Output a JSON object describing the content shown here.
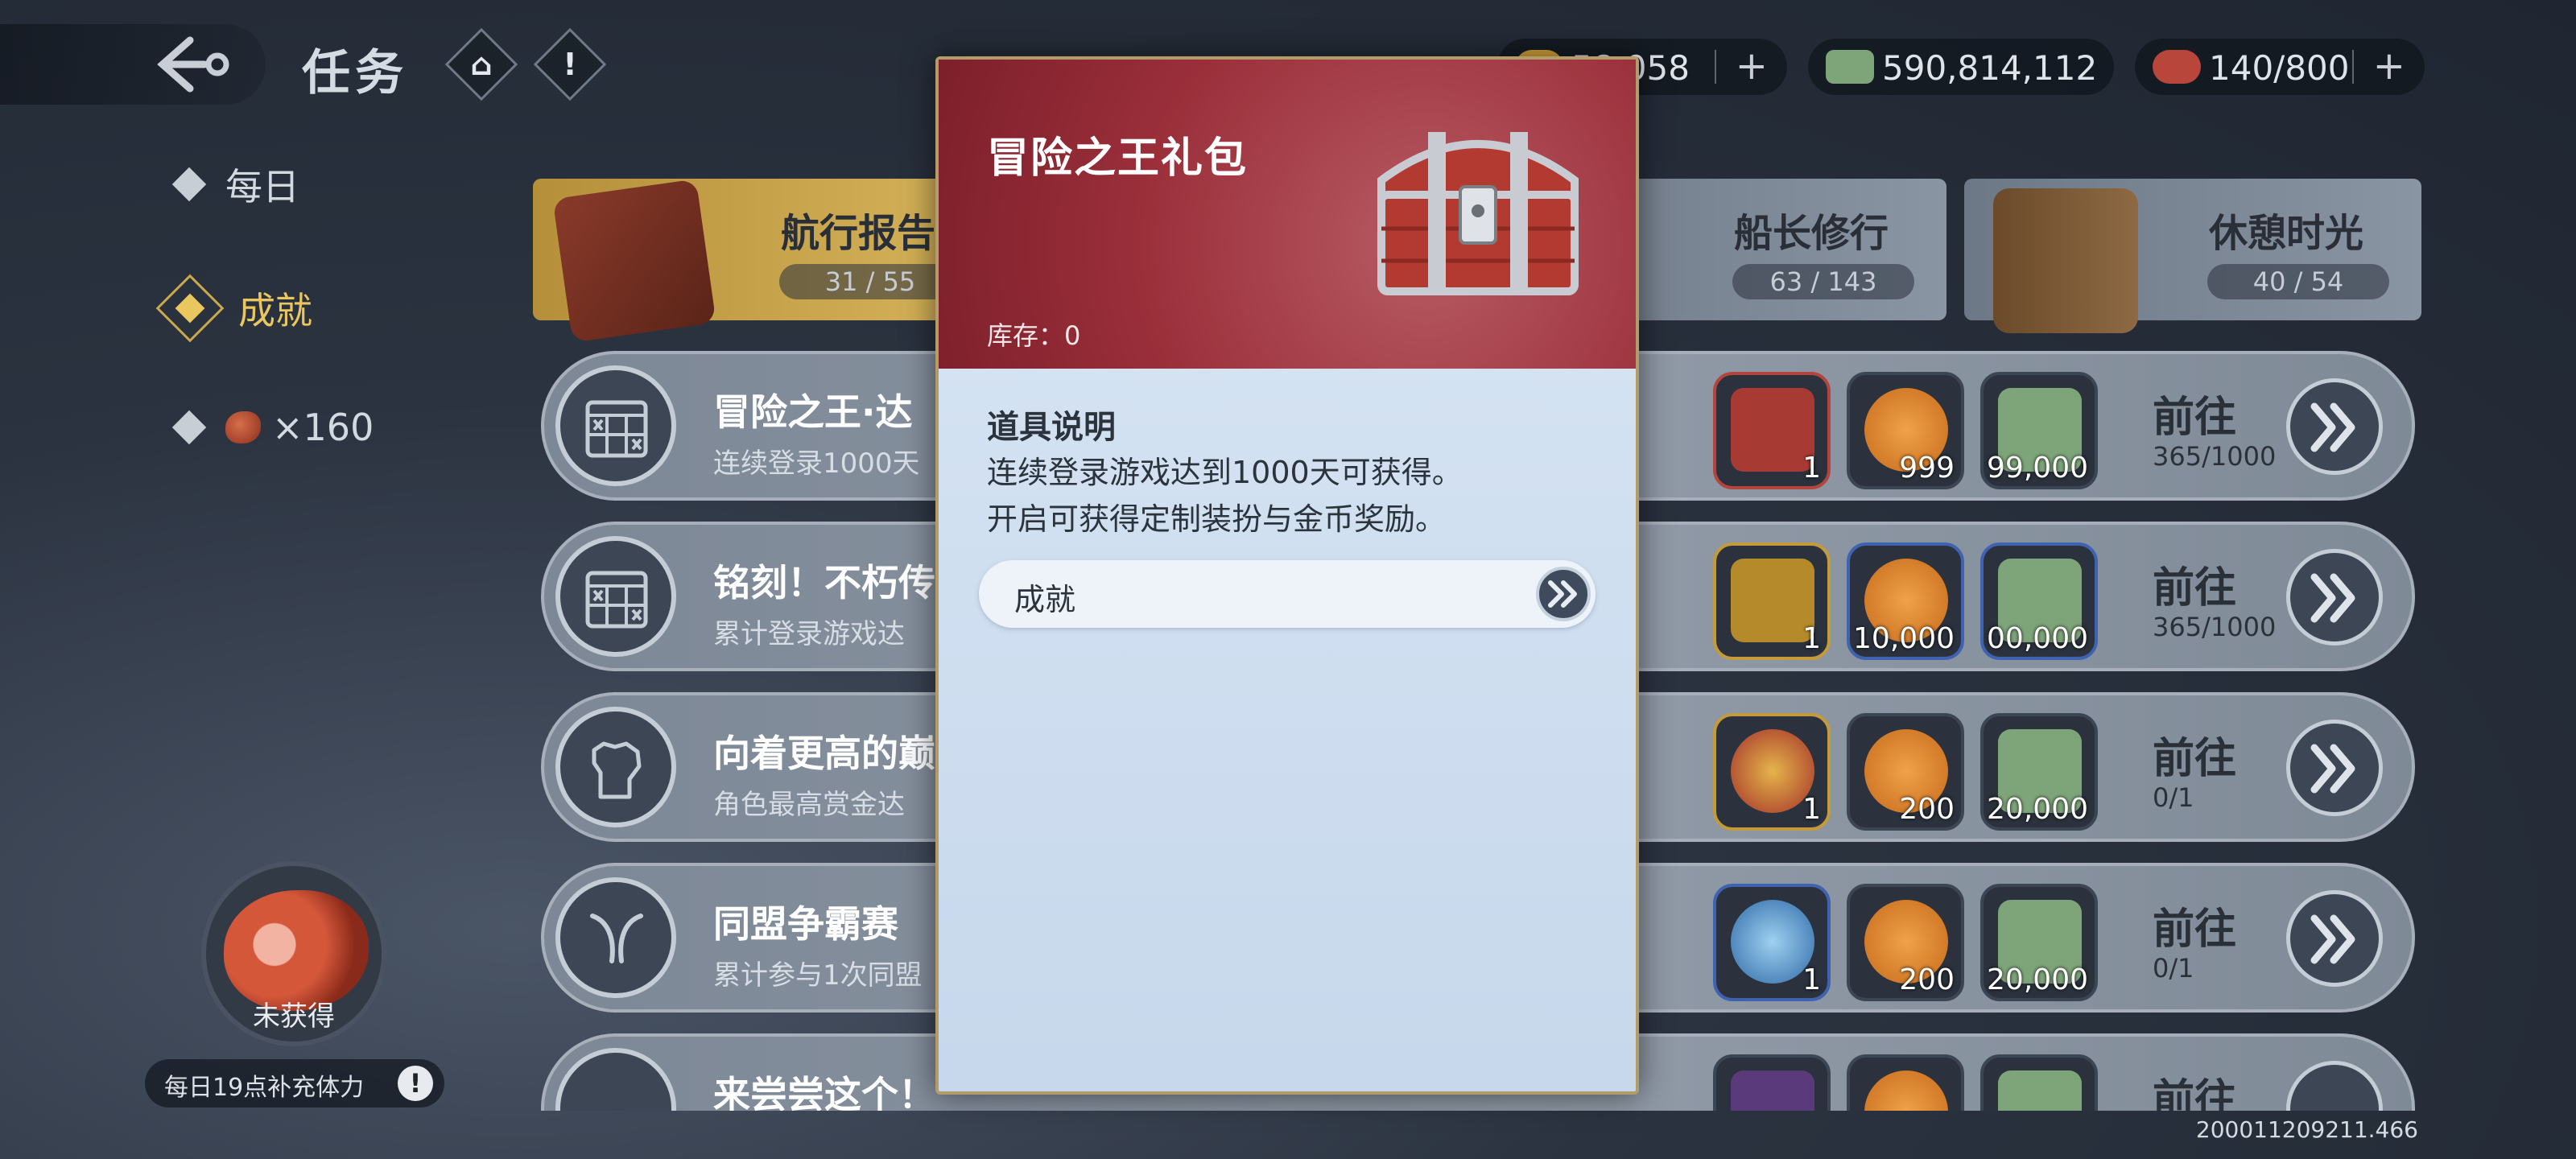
{
  "header": {
    "title": "任务",
    "home_icon": "home-icon",
    "alert_icon": "exclamation-icon",
    "resources": [
      {
        "name": "gold",
        "value": "58,058",
        "color": "#d4a23a"
      },
      {
        "name": "cash",
        "value": "590,814,112",
        "color": "#7ea57a"
      },
      {
        "name": "stamina",
        "value": "140/800",
        "color": "#b8463a"
      }
    ]
  },
  "sidebar": {
    "items": [
      {
        "label": "每日"
      },
      {
        "label": "成就",
        "active": true
      },
      {
        "label": "×160",
        "icon": "meat-icon"
      }
    ]
  },
  "categories": [
    {
      "name": "航行报告",
      "count": "31 / 55",
      "active": true
    },
    {
      "name": "船长修行",
      "count": "63 / 143"
    },
    {
      "name": "休憩时光",
      "count": "40 / 54"
    }
  ],
  "tasks": [
    {
      "title": "冒险之王·达",
      "desc": "连续登录1000天",
      "icon": "calendar-icon",
      "rewards": [
        {
          "qty": "1",
          "art": "chest-red"
        },
        {
          "qty": "999",
          "art": "coin"
        },
        {
          "qty": "99,000",
          "art": "cash"
        }
      ],
      "goto": "前往",
      "progress": "365/1000"
    },
    {
      "title": "铭刻！不朽传",
      "desc": "累计登录游戏达",
      "icon": "calendar-icon",
      "rewards": [
        {
          "qty": "1",
          "art": "chest-gold"
        },
        {
          "qty": "10,000",
          "art": "coin"
        },
        {
          "qty": "00,000",
          "art": "cash"
        }
      ],
      "goto": "前往",
      "progress": "365/1000"
    },
    {
      "title": "向着更高的巅",
      "desc": "角色最高赏金达",
      "icon": "fist-icon",
      "rewards": [
        {
          "qty": "1",
          "art": "medal"
        },
        {
          "qty": "200",
          "art": "coin"
        },
        {
          "qty": "20,000",
          "art": "cash"
        }
      ],
      "goto": "前往",
      "progress": "0/1"
    },
    {
      "title": "同盟争霸赛",
      "desc": "累计参与1次同盟",
      "icon": "horn-icon",
      "rewards": [
        {
          "qty": "1",
          "art": "orb"
        },
        {
          "qty": "200",
          "art": "coin"
        },
        {
          "qty": "20,000",
          "art": "cash"
        }
      ],
      "goto": "前往",
      "progress": "0/1"
    },
    {
      "title": "来尝尝这个！",
      "desc": "",
      "icon": "fish-icon",
      "rewards": [
        {
          "qty": "",
          "art": "box"
        },
        {
          "qty": "",
          "art": "coin"
        },
        {
          "qty": "",
          "art": "cash"
        }
      ],
      "goto": "前往",
      "progress": ""
    }
  ],
  "stamina_widget": {
    "status": "未获得",
    "note": "每日19点补充体力"
  },
  "build_id": "200011209211.466",
  "modal": {
    "title": "冒险之王礼包",
    "stock": "库存：0",
    "section_title": "道具说明",
    "desc_line1": "连续登录游戏达到1000天可获得。",
    "desc_line2": "开启可获得定制装扮与金币奖励。",
    "source_label": "成就"
  }
}
